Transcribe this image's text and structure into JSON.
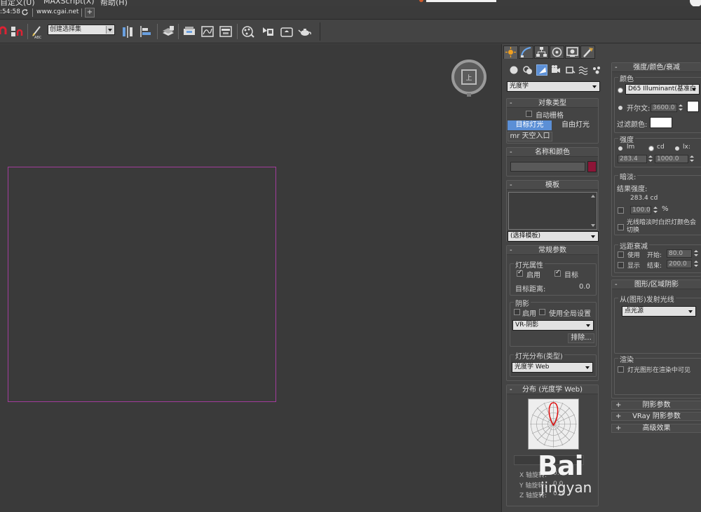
{
  "menubar": {
    "items": [
      "自定义(U)",
      "MAXScript(X)",
      "帮助(H)"
    ]
  },
  "infobar": {
    "clock": ":54:58",
    "url": "www.cgai.net",
    "add_tab": "+"
  },
  "toolbar": {
    "selection_set": "创建选择集"
  },
  "colors": {
    "accent": "#5b8fd6",
    "selection_rect": "#a23c9c",
    "name_swatch": "#8c1537",
    "distribution_curve": "#e01010"
  },
  "panel": {
    "category": "光度学",
    "object_type": {
      "title": "对象类型",
      "autogrid": "自动栅格",
      "target_light": "目标灯光",
      "free_light": "自由灯光",
      "sky_portal": "mr 天空入口"
    },
    "name_color": {
      "title": "名称和颜色"
    },
    "template": {
      "title": "模板",
      "select": "(选择模板)"
    },
    "general": {
      "title": "常规参数",
      "light_props": "灯光属性",
      "enable": "启用",
      "target": "目标",
      "target_dist_label": "目标距离:",
      "target_dist": "0.0",
      "shadows": "阴影",
      "shadow_enable": "启用",
      "use_global": "使用全局设置",
      "shadow_type": "VR-阴影",
      "exclude": "排除...",
      "distribution": "灯光分布(类型)",
      "distribution_type": "光度学 Web"
    },
    "web": {
      "title": "分布 (光度学 Web)",
      "x_rot": "X 轴旋转:",
      "y_rot": "Y 轴旋转:",
      "z_rot": "Z 轴旋转:",
      "x_val": "0.0",
      "y_val": "0.0",
      "z_val": "0.0"
    }
  },
  "panel2": {
    "intensity": {
      "title": "强度/颜色/衰减",
      "color_group": "颜色",
      "preset": "D65 Illuminant(基准白",
      "kelvin_label": "开尔文:",
      "kelvin": "3600.0",
      "filter_color": "过滤颜色:",
      "strength": "强度",
      "lm": "lm",
      "cd": "cd",
      "lx": "lx:",
      "val1": "283.4",
      "val2": "1000.0",
      "dimming": "暗淡:",
      "result_strength": "结果强度:",
      "result_val": "283.4 cd",
      "percent_val": "100.0",
      "percent": "%",
      "incandescent": "光线暗淡时白炽灯颜色会切换",
      "far_atten": "远距衰减",
      "use": "使用",
      "start": "开始:",
      "start_val": "80.0",
      "show": "显示",
      "end": "结束:",
      "end_val": "200.0"
    },
    "shape": {
      "title": "图形/区域阴影",
      "emit": "从(图形)发射光线",
      "emit_type": "点光源",
      "render": "渲染",
      "visible_in_render": "灯光图形在渲染中可见"
    },
    "collapsed": [
      "阴影参数",
      "VRay 阴影参数",
      "高级效果"
    ]
  },
  "watermark": {
    "line1": "Bai",
    "line2": "jingyan"
  }
}
